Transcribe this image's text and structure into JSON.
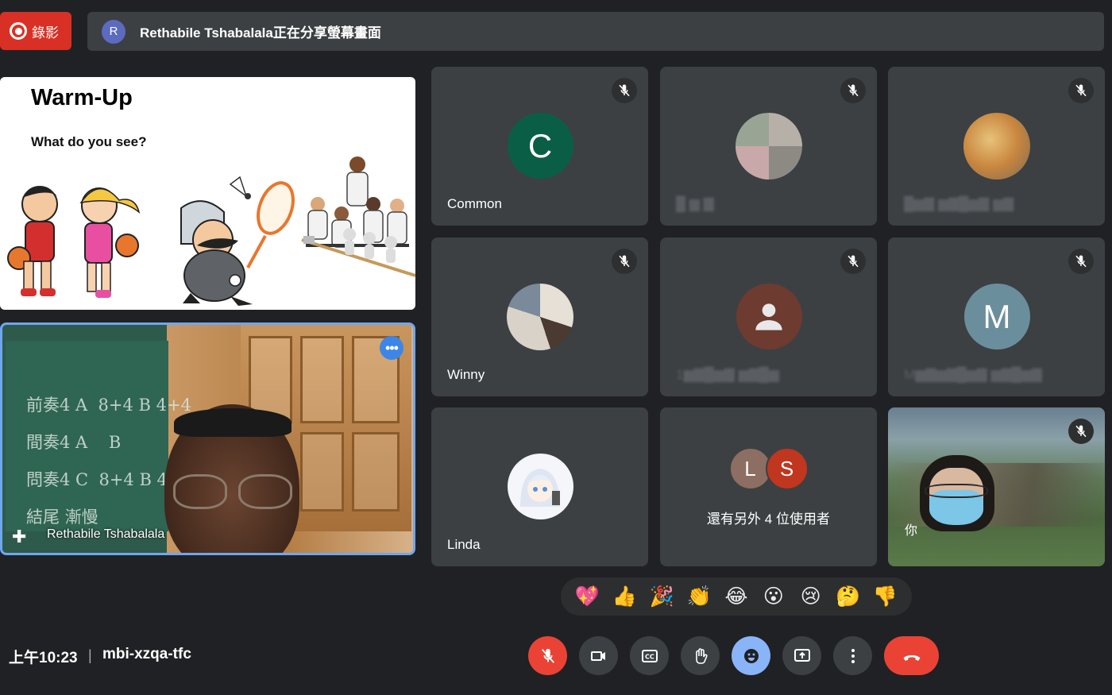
{
  "recording": {
    "label": "錄影"
  },
  "banner": {
    "avatar_letter": "R",
    "text": "Rethabile Tshabalala正在分享螢幕畫面"
  },
  "slide": {
    "title": "Warm-Up",
    "subtitle": "What do you see?"
  },
  "presenter": {
    "name": "Rethabile Tshabalala",
    "board_text": "前奏4 A  8+4 B 4+4\n間奏4 A    B\n問奏4 C  8+4 B 4+4\n結尾 漸慢"
  },
  "tiles": [
    {
      "name": "Common",
      "avatar_letter": "C",
      "avatar_color": "#0b5e46"
    },
    {
      "name": "",
      "avatar_letter": "",
      "avatar_color": ""
    },
    {
      "name": "",
      "avatar_letter": "",
      "avatar_color": ""
    },
    {
      "name": "Winny",
      "avatar_letter": "",
      "avatar_color": ""
    },
    {
      "name": "",
      "avatar_letter": "",
      "avatar_color": "#6d3b30"
    },
    {
      "name": "",
      "avatar_letter": "M",
      "avatar_color": "#6b8e9c"
    },
    {
      "name": "Linda",
      "avatar_letter": "",
      "avatar_color": ""
    }
  ],
  "more_users": {
    "avatar_1": "L",
    "avatar_1_color": "#8d6e63",
    "avatar_2": "S",
    "avatar_2_color": "#c0361f",
    "text": "還有另外 4 位使用者"
  },
  "self": {
    "name": "你"
  },
  "reactions": [
    "💖",
    "👍",
    "🎉",
    "👏",
    "😂",
    "😮",
    "😢",
    "🤔",
    "👎"
  ],
  "footer": {
    "time": "上午10:23",
    "separator": "|",
    "meeting_code": "mbi-xzqa-tfc"
  }
}
